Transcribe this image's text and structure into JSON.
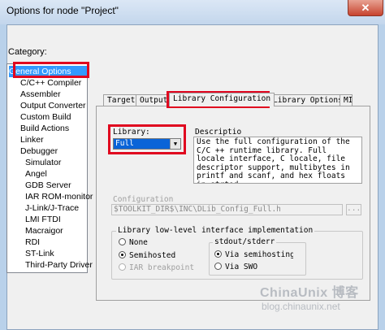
{
  "window": {
    "title": "Options for node \"Project\"",
    "close_glyph": "✕"
  },
  "category": {
    "label": "Category:",
    "items": [
      "General Options",
      "C/C++ Compiler",
      "Assembler",
      "Output Converter",
      "Custom Build",
      "Build Actions",
      "Linker",
      "Debugger",
      "Simulator",
      "Angel",
      "GDB Server",
      "IAR ROM-monitor",
      "J-Link/J-Trace",
      "LMI FTDI",
      "Macraigor",
      "RDI",
      "ST-Link",
      "Third-Party Driver"
    ],
    "selected": "General Options"
  },
  "tabs": [
    "Target",
    "Output",
    "Library Configuration",
    "Library Options",
    "MI"
  ],
  "active_tab": "Library Configuration",
  "library": {
    "label": "Library:",
    "value": "Full"
  },
  "description": {
    "label": "Descriptio",
    "text": "Use the full configuration of the C/C ++ runtime library. Full locale interface, C locale, file descriptor support, multibytes in printf and scanf, and hex floats in strtod."
  },
  "configuration": {
    "label": "Configuration",
    "value": "$TOOLKIT_DIR$\\INC\\DLib_Config_Full.h",
    "browse_label": "..."
  },
  "low_level": {
    "title": "Library low-level interface implementation",
    "options": [
      {
        "label": "None",
        "checked": false,
        "disabled": false
      },
      {
        "label": "Semihosted",
        "checked": true,
        "disabled": false
      },
      {
        "label": "IAR breakpoint",
        "checked": false,
        "disabled": true
      }
    ]
  },
  "stdout": {
    "title": "stdout/stderr",
    "options": [
      {
        "label": "Via semihosting",
        "checked": true
      },
      {
        "label": "Via SWO",
        "checked": false
      }
    ]
  },
  "watermark": {
    "main": "ChinaUnix 博客",
    "sub": "blog.chinaunix.net"
  },
  "colors": {
    "highlight_red": "#e0061f",
    "selection_blue": "#3399ff"
  }
}
